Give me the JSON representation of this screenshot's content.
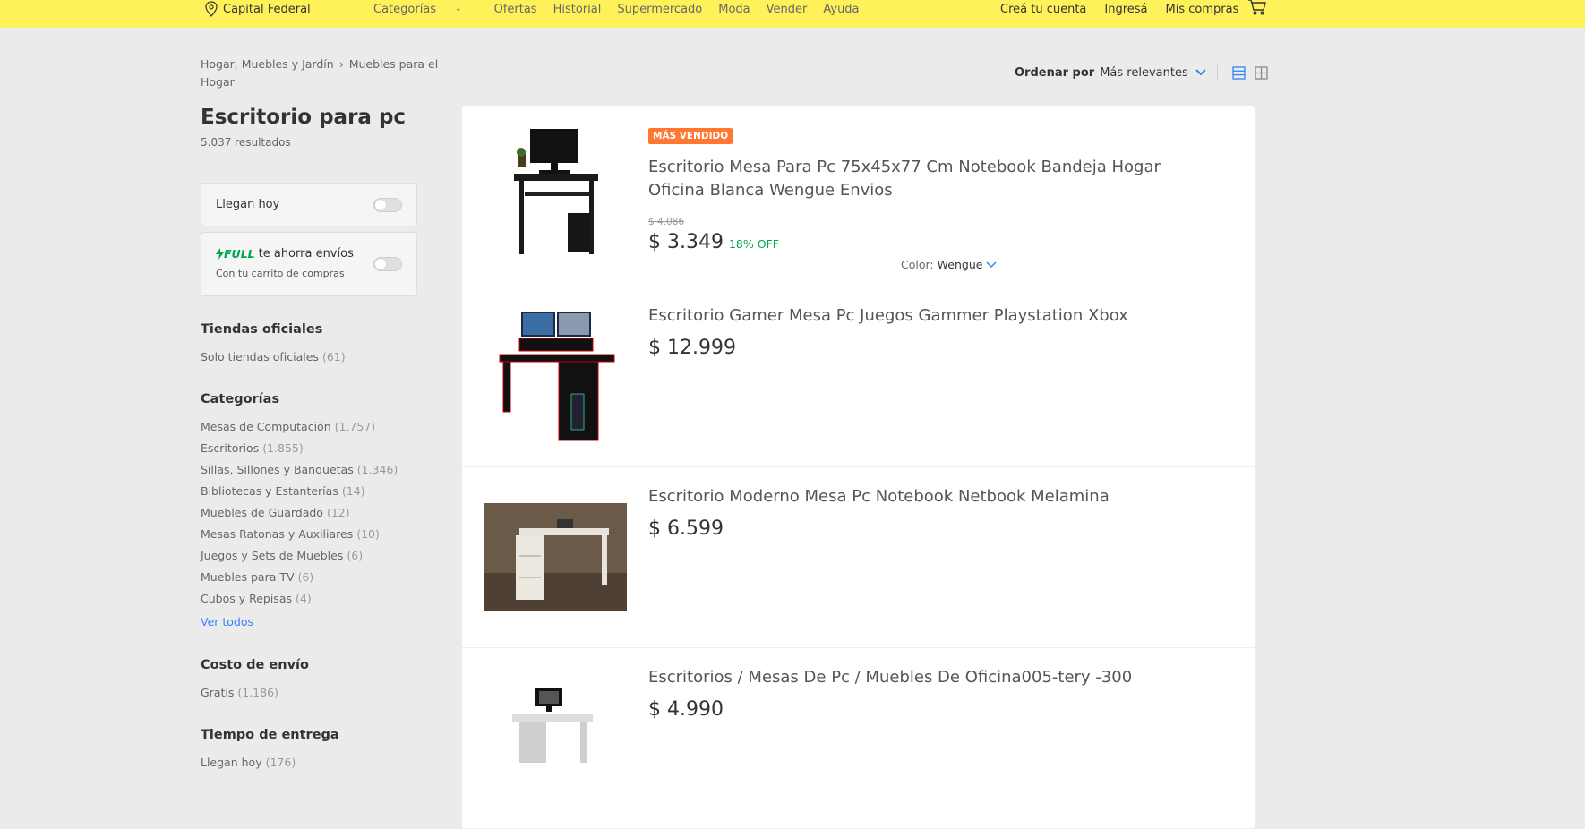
{
  "header": {
    "location": "Capital Federal",
    "nav": [
      "Categorías",
      "Ofertas",
      "Historial",
      "Supermercado",
      "Moda",
      "Vender",
      "Ayuda"
    ],
    "user_nav": [
      "Creá tu cuenta",
      "Ingresá",
      "Mis compras"
    ]
  },
  "breadcrumb": {
    "parent": "Hogar, Muebles y Jardín",
    "current": "Muebles para el Hogar"
  },
  "search": {
    "title": "Escritorio para pc",
    "results": "5.037 resultados"
  },
  "filters": {
    "llegan_hoy": "Llegan hoy",
    "full": {
      "brand": "FULL",
      "label": "te ahorra envíos",
      "sub": "Con tu carrito de compras"
    }
  },
  "tiendas": {
    "title": "Tiendas oficiales",
    "item": "Solo tiendas oficiales",
    "count": "(61)"
  },
  "categorias": {
    "title": "Categorías",
    "items": [
      {
        "label": "Mesas de Computación",
        "count": "(1.757)"
      },
      {
        "label": "Escritorios",
        "count": "(1.855)"
      },
      {
        "label": "Sillas, Sillones y Banquetas",
        "count": "(1.346)"
      },
      {
        "label": "Bibliotecas y Estanterías",
        "count": "(14)"
      },
      {
        "label": "Muebles de Guardado",
        "count": "(12)"
      },
      {
        "label": "Mesas Ratonas y Auxiliares",
        "count": "(10)"
      },
      {
        "label": "Juegos y Sets de Muebles",
        "count": "(6)"
      },
      {
        "label": "Muebles para TV",
        "count": "(6)"
      },
      {
        "label": "Cubos y Repisas",
        "count": "(4)"
      }
    ],
    "ver_todos": "Ver todos"
  },
  "envio": {
    "title": "Costo de envío",
    "item": "Gratis",
    "count": "(1.186)"
  },
  "entrega": {
    "title": "Tiempo de entrega",
    "item": "Llegan hoy",
    "count": "(176)"
  },
  "sort": {
    "label": "Ordenar por",
    "value": "Más relevantes"
  },
  "products": [
    {
      "badge": "MÁS VENDIDO",
      "title": "Escritorio Mesa Para Pc 75x45x77 Cm Notebook Bandeja Hogar Oficina Blanca Wengue Envios",
      "old_price": "$ 4.086",
      "price": "$ 3.349",
      "discount": "18% OFF",
      "color_label": "Color:",
      "color_value": "Wengue"
    },
    {
      "title": "Escritorio Gamer Mesa Pc Juegos Gammer Playstation Xbox",
      "price": "$ 12.999"
    },
    {
      "title": "Escritorio Moderno Mesa Pc Notebook Netbook Melamina",
      "price": "$ 6.599"
    },
    {
      "title": "Escritorios / Mesas De Pc / Muebles De Oficina005-tery -300",
      "price": "$ 4.990"
    }
  ],
  "colors": {
    "header_yellow": "#fff159",
    "accent_blue": "#3483fa",
    "discount_green": "#00a650",
    "badge_orange": "#ff7733"
  }
}
